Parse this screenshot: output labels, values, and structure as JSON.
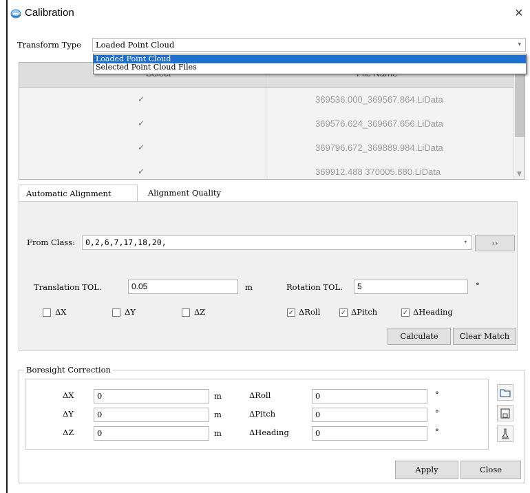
{
  "window": {
    "title": "Calibration",
    "close_glyph": "×",
    "icon": "globe-icon"
  },
  "transform": {
    "label": "Transform Type",
    "value": "Loaded Point Cloud",
    "options": [
      "Loaded Point Cloud",
      "Selected Point Cloud Files"
    ]
  },
  "table": {
    "headers": [
      "Select",
      "File Name"
    ],
    "rows": [
      {
        "checked": "✓",
        "file": "369536.000_369567.864.LiData"
      },
      {
        "checked": "✓",
        "file": "369576.624_369667.656.LiData"
      },
      {
        "checked": "✓",
        "file": "369796.672_369889.984.LiData"
      },
      {
        "checked": "✓",
        "file": "369912.488 370005.880.LiData"
      }
    ]
  },
  "tabs": [
    "Automatic Alignment",
    "Alignment Quality"
  ],
  "alignment": {
    "from_class_label": "From Class:",
    "from_class_value": "0,2,6,7,17,18,20,",
    "more_button": "››",
    "translation_label": "Translation TOL.",
    "translation_value": "0.05",
    "translation_unit": "m",
    "rotation_label": "Rotation TOL.",
    "rotation_value": "5",
    "rotation_unit": "°",
    "checks": [
      {
        "label": "ΔX",
        "checked": ""
      },
      {
        "label": "ΔY",
        "checked": ""
      },
      {
        "label": "ΔZ",
        "checked": ""
      },
      {
        "label": "ΔRoll",
        "checked": "✓"
      },
      {
        "label": "ΔPitch",
        "checked": "✓"
      },
      {
        "label": "ΔHeading",
        "checked": "✓"
      }
    ],
    "calculate_button": "Calculate",
    "clear_button": "Clear Match"
  },
  "boresight": {
    "title": "Boresight Correction",
    "left": [
      {
        "label": "ΔX",
        "value": "0",
        "unit": "m"
      },
      {
        "label": "ΔY",
        "value": "0",
        "unit": "m"
      },
      {
        "label": "ΔZ",
        "value": "0",
        "unit": "m"
      }
    ],
    "right": [
      {
        "label": "ΔRoll",
        "value": "0",
        "unit": "°"
      },
      {
        "label": "ΔPitch",
        "value": "0",
        "unit": "°"
      },
      {
        "label": "ΔHeading",
        "value": "0",
        "unit": "°"
      }
    ],
    "icons": [
      "folder-open-icon",
      "save-icon",
      "clear-brush-icon"
    ],
    "apply_button": "Apply",
    "close_button": "Close"
  }
}
